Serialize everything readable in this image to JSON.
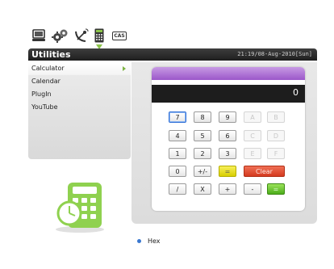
{
  "top_icons": [
    {
      "icon": "monitor-icon"
    },
    {
      "icon": "gears-icon"
    },
    {
      "icon": "satellite-dish-icon"
    },
    {
      "icon": "calculator-icon"
    },
    {
      "icon": "cas-card-icon",
      "label": "CAS"
    }
  ],
  "header": {
    "title": "Utilities",
    "clock": "21:19/08-Aug-2010[Sun]"
  },
  "menu": {
    "items": [
      {
        "label": "Calculator",
        "active": true
      },
      {
        "label": "Calendar"
      },
      {
        "label": "PlugIn"
      },
      {
        "label": "YouTube"
      }
    ]
  },
  "calculator": {
    "display": "0",
    "rows": [
      [
        "7",
        "8",
        "9",
        "A",
        "B"
      ],
      [
        "4",
        "5",
        "6",
        "C",
        "D"
      ],
      [
        "1",
        "2",
        "3",
        "E",
        "F"
      ],
      [
        "0",
        "+/-",
        "=",
        "Clear"
      ],
      [
        "/",
        "X",
        "+",
        "-",
        "="
      ]
    ]
  },
  "mode": {
    "label": "Hex"
  },
  "colors": {
    "accent_green": "#8bc34a",
    "display_bg": "#1d1d1d",
    "purple_bar": "#b27ad8",
    "clear_red": "#e04b2e",
    "equals_yellow": "#e8df1c",
    "ok_green": "#5cbf24"
  }
}
